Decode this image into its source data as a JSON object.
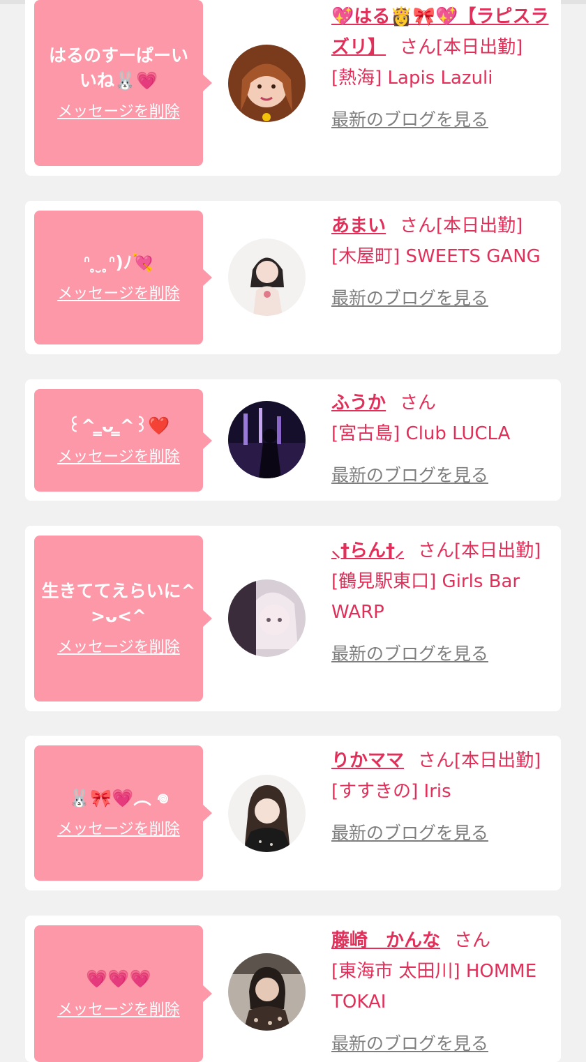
{
  "colors": {
    "accent": "#e0305a",
    "bubble": "#fd98a8",
    "background": "#f1f1f1",
    "blog_link": "#7e7e7e"
  },
  "common": {
    "delete_label": "メッセージを削除",
    "blog_label": "最新のブログを見る",
    "san_label": "さん"
  },
  "entries": [
    {
      "message": "はるのすーぱーいいね🐰💗",
      "name": "💖はる👸🎀💖【ラピスラズリ】",
      "status": "[本日出勤]",
      "shop": "[熱海] Lapis Lazuli"
    },
    {
      "message": "ᐢ ̥ ̮ ̥ᐢ)ﾉ💘",
      "name": "あまい",
      "status": "[本日出勤]",
      "shop": "[木屋町] SWEETS GANG"
    },
    {
      "message": "꒰^ ̳ᴗ ̳^꒱❤️",
      "name": "ふうか",
      "status": "",
      "shop": "[宮古島] Club LUCLA"
    },
    {
      "message": "生きててえらいに^>ᴗ<^",
      "name": "⸜†らん†⸝",
      "status": "[本日出勤]",
      "shop": "[鶴見駅東口] Girls Bar WARP"
    },
    {
      "message": "🐰🎀💗︵ 𖦹",
      "name": "りかママ",
      "status": "[本日出勤]",
      "shop": "[すすきの] Iris"
    },
    {
      "message": "💗💗💗",
      "name": "藤崎　かんな",
      "status": "",
      "shop": "[東海市 太田川] HOMME TOKAI"
    }
  ]
}
